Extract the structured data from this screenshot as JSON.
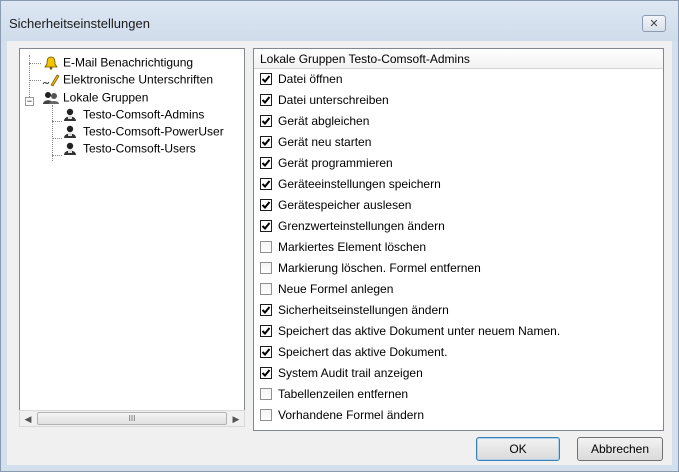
{
  "window": {
    "title": "Sicherheitseinstellungen",
    "close_glyph": "✕"
  },
  "tree": {
    "items": [
      {
        "label": "E-Mail Benachrichtigung",
        "icon": "bell-icon"
      },
      {
        "label": "Elektronische Unterschriften",
        "icon": "signature-icon"
      },
      {
        "label": "Lokale Gruppen",
        "icon": "group-icon",
        "expander": "−"
      },
      {
        "label": "Testo-Comsoft-Admins",
        "icon": "user-icon"
      },
      {
        "label": "Testo-Comsoft-PowerUser",
        "icon": "user-icon"
      },
      {
        "label": "Testo-Comsoft-Users",
        "icon": "user-icon"
      }
    ],
    "scroll_thumb": "III"
  },
  "list": {
    "header": "Lokale Gruppen Testo-Comsoft-Admins",
    "items": [
      {
        "label": "Datei öffnen",
        "checked": true
      },
      {
        "label": "Datei unterschreiben",
        "checked": true
      },
      {
        "label": "Gerät abgleichen",
        "checked": true
      },
      {
        "label": "Gerät neu starten",
        "checked": true
      },
      {
        "label": "Gerät programmieren",
        "checked": true
      },
      {
        "label": "Geräteeinstellungen speichern",
        "checked": true
      },
      {
        "label": "Gerätespeicher auslesen",
        "checked": true
      },
      {
        "label": "Grenzwerteinstellungen ändern",
        "checked": true
      },
      {
        "label": "Markiertes Element löschen",
        "checked": false
      },
      {
        "label": "Markierung löschen. Formel entfernen",
        "checked": false
      },
      {
        "label": "Neue Formel anlegen",
        "checked": false
      },
      {
        "label": "Sicherheitseinstellungen ändern",
        "checked": true
      },
      {
        "label": "Speichert das aktive Dokument unter neuem Namen.",
        "checked": true
      },
      {
        "label": "Speichert das aktive Dokument.",
        "checked": true
      },
      {
        "label": "System Audit trail anzeigen",
        "checked": true
      },
      {
        "label": "Tabellenzeilen entfernen",
        "checked": false
      },
      {
        "label": "Vorhandene Formel ändern",
        "checked": false
      }
    ]
  },
  "buttons": {
    "ok": "OK",
    "cancel": "Abbrechen"
  }
}
